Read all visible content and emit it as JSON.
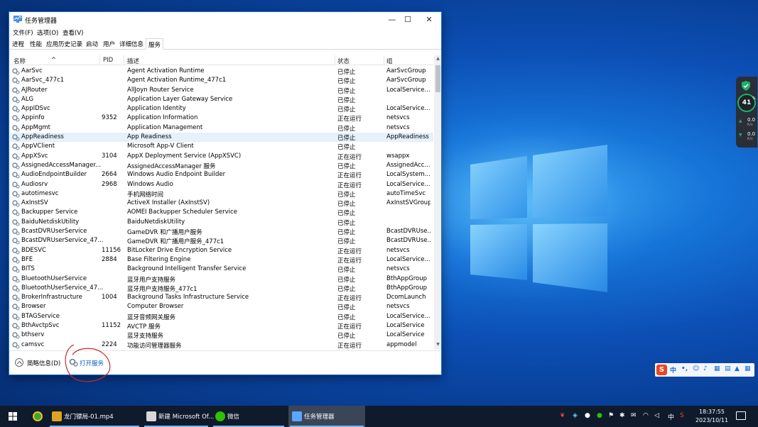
{
  "window": {
    "title": "任务管理器",
    "minimize": "—",
    "maximize": "☐",
    "close": "✕"
  },
  "menu": [
    "文件(F)",
    "选项(O)",
    "查看(V)"
  ],
  "tabs": [
    "进程",
    "性能",
    "应用历史记录",
    "启动",
    "用户",
    "详细信息",
    "服务"
  ],
  "active_tab": "服务",
  "columns": {
    "name": "名称",
    "pid": "PID",
    "desc": "描述",
    "status": "状态",
    "group": "组"
  },
  "rows": [
    {
      "name": "AarSvc",
      "pid": "",
      "desc": "Agent Activation Runtime",
      "status": "已停止",
      "group": "AarSvcGroup"
    },
    {
      "name": "AarSvc_477c1",
      "pid": "",
      "desc": "Agent Activation Runtime_477c1",
      "status": "已停止",
      "group": "AarSvcGroup"
    },
    {
      "name": "AJRouter",
      "pid": "",
      "desc": "AllJoyn Router Service",
      "status": "已停止",
      "group": "LocalService..."
    },
    {
      "name": "ALG",
      "pid": "",
      "desc": "Application Layer Gateway Service",
      "status": "已停止",
      "group": ""
    },
    {
      "name": "AppIDSvc",
      "pid": "",
      "desc": "Application Identity",
      "status": "已停止",
      "group": "LocalService..."
    },
    {
      "name": "Appinfo",
      "pid": "9352",
      "desc": "Application Information",
      "status": "正在运行",
      "group": "netsvcs"
    },
    {
      "name": "AppMgmt",
      "pid": "",
      "desc": "Application Management",
      "status": "已停止",
      "group": "netsvcs"
    },
    {
      "name": "AppReadiness",
      "pid": "",
      "desc": "App Readiness",
      "status": "已停止",
      "group": "AppReadiness"
    },
    {
      "name": "AppVClient",
      "pid": "",
      "desc": "Microsoft App-V Client",
      "status": "已停止",
      "group": ""
    },
    {
      "name": "AppXSvc",
      "pid": "3104",
      "desc": "AppX Deployment Service (AppXSVC)",
      "status": "正在运行",
      "group": "wsappx"
    },
    {
      "name": "AssignedAccessManager...",
      "pid": "",
      "desc": "AssignedAccessManager 服务",
      "status": "已停止",
      "group": "AssignedAcc..."
    },
    {
      "name": "AudioEndpointBuilder",
      "pid": "2664",
      "desc": "Windows Audio Endpoint Builder",
      "status": "正在运行",
      "group": "LocalSystem..."
    },
    {
      "name": "Audiosrv",
      "pid": "2968",
      "desc": "Windows Audio",
      "status": "正在运行",
      "group": "LocalService..."
    },
    {
      "name": "autotimesvc",
      "pid": "",
      "desc": "手机网络时间",
      "status": "已停止",
      "group": "autoTimeSvc"
    },
    {
      "name": "AxInstSV",
      "pid": "",
      "desc": "ActiveX Installer (AxInstSV)",
      "status": "已停止",
      "group": "AxInstSVGroup"
    },
    {
      "name": "Backupper Service",
      "pid": "",
      "desc": "AOMEI Backupper Scheduler Service",
      "status": "已停止",
      "group": ""
    },
    {
      "name": "BaiduNetdiskUtility",
      "pid": "",
      "desc": "BaiduNetdiskUtility",
      "status": "已停止",
      "group": ""
    },
    {
      "name": "BcastDVRUserService",
      "pid": "",
      "desc": "GameDVR 和广播用户服务",
      "status": "已停止",
      "group": "BcastDVRUse..."
    },
    {
      "name": "BcastDVRUserService_47...",
      "pid": "",
      "desc": "GameDVR 和广播用户服务_477c1",
      "status": "已停止",
      "group": "BcastDVRUse..."
    },
    {
      "name": "BDESVC",
      "pid": "11156",
      "desc": "BitLocker Drive Encryption Service",
      "status": "正在运行",
      "group": "netsvcs"
    },
    {
      "name": "BFE",
      "pid": "2884",
      "desc": "Base Filtering Engine",
      "status": "正在运行",
      "group": "LocalService..."
    },
    {
      "name": "BITS",
      "pid": "",
      "desc": "Background Intelligent Transfer Service",
      "status": "已停止",
      "group": "netsvcs"
    },
    {
      "name": "BluetoothUserService",
      "pid": "",
      "desc": "蓝牙用户支持服务",
      "status": "已停止",
      "group": "BthAppGroup"
    },
    {
      "name": "BluetoothUserService_47...",
      "pid": "",
      "desc": "蓝牙用户支持服务_477c1",
      "status": "已停止",
      "group": "BthAppGroup"
    },
    {
      "name": "BrokerInfrastructure",
      "pid": "1004",
      "desc": "Background Tasks Infrastructure Service",
      "status": "正在运行",
      "group": "DcomLaunch"
    },
    {
      "name": "Browser",
      "pid": "",
      "desc": "Computer Browser",
      "status": "已停止",
      "group": "netsvcs"
    },
    {
      "name": "BTAGService",
      "pid": "",
      "desc": "蓝牙音频网关服务",
      "status": "已停止",
      "group": "LocalService..."
    },
    {
      "name": "BthAvctpSvc",
      "pid": "11152",
      "desc": "AVCTP 服务",
      "status": "正在运行",
      "group": "LocalService"
    },
    {
      "name": "bthserv",
      "pid": "",
      "desc": "蓝牙支持服务",
      "status": "已停止",
      "group": "LocalService"
    },
    {
      "name": "camsvc",
      "pid": "2224",
      "desc": "功能访问管理器服务",
      "status": "正在运行",
      "group": "appmodel"
    }
  ],
  "selected_row_index": 7,
  "footer": {
    "collapse_label": "简略信息(D)",
    "open_services": "打开服务"
  },
  "widget": {
    "percent": "41",
    "pct_sign": "%",
    "up_value": "0.0",
    "up_unit": "K/s",
    "down_value": "0.0",
    "down_unit": "K/s"
  },
  "ime": {
    "logo": "S",
    "lang": "中"
  },
  "taskbar": {
    "items": [
      {
        "label": "龙门镖局-01.mp4",
        "icon_color": "#e0a31f"
      },
      {
        "label": "新建 Microsoft Of...",
        "icon_color": "#d7d7d7"
      },
      {
        "label": "微信",
        "icon_color": "#2dc100"
      },
      {
        "label": "任务管理器",
        "icon_color": "#5ba6ff"
      }
    ],
    "tray_lang": "中",
    "time": "18:37:55",
    "date": "2023/10/11"
  },
  "colors": {
    "accent": "#0a5fbf",
    "selected_row": "#e5f1fb",
    "desktop": "#0c4fb5",
    "taskbar": "#0f1a2c"
  }
}
